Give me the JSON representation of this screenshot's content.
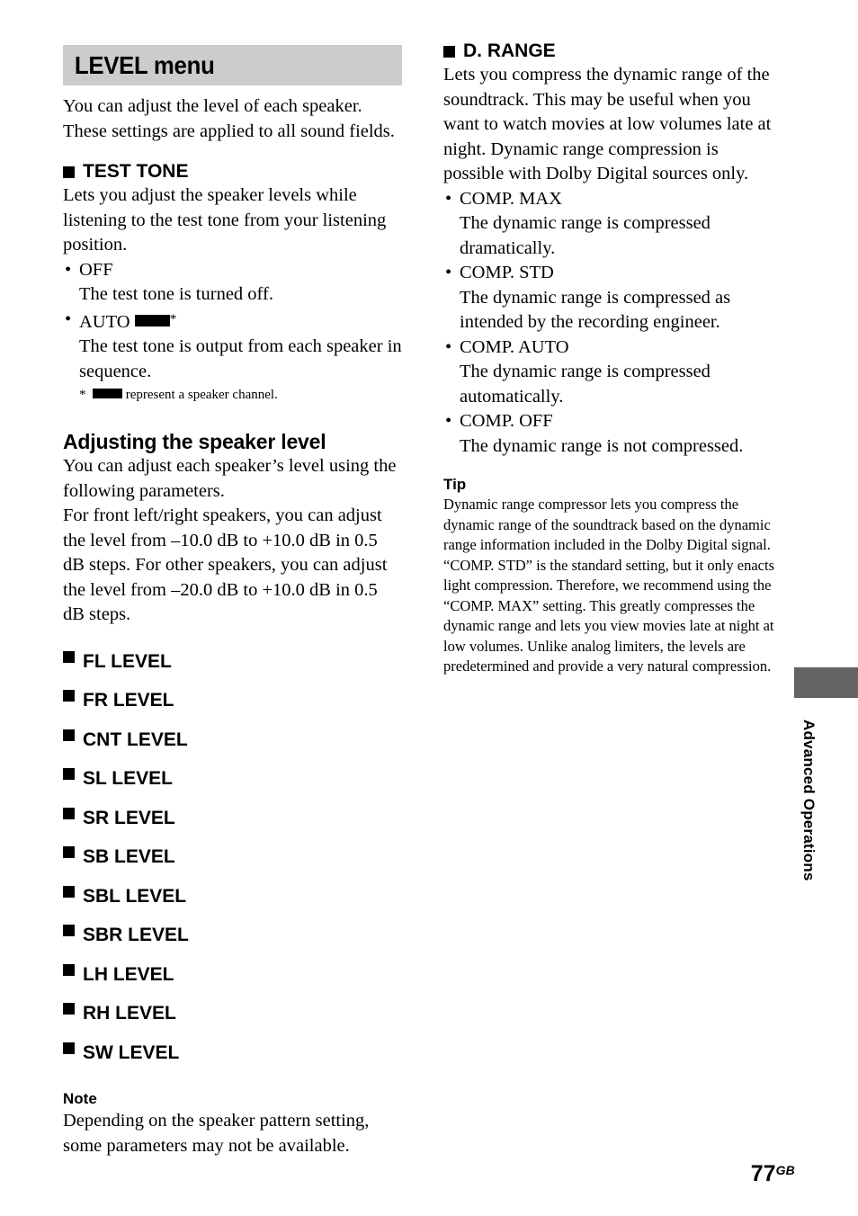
{
  "page": {
    "number": "77",
    "region_code": "GB",
    "side_tab_label": "Advanced Operations"
  },
  "left_column": {
    "banner_title": "LEVEL menu",
    "intro": "You can adjust the level of each speaker. These settings are applied to all sound fields.",
    "test_tone": {
      "heading": "TEST TONE",
      "description": "Lets you adjust the speaker levels while listening to the test tone from your listening position.",
      "options": [
        {
          "label": "OFF",
          "description": "The test tone is turned off."
        },
        {
          "label": "AUTO",
          "description": "The test tone is output from each speaker in sequence."
        }
      ],
      "footnote": "represent a speaker channel."
    },
    "adjusting": {
      "heading": "Adjusting the speaker level",
      "paragraph_1": "You can adjust each speaker’s level using the following parameters.",
      "paragraph_2": "For front left/right speakers, you can adjust the level from –10.0 dB to +10.0 dB in 0.5 dB steps. For other speakers, you can adjust the level from –20.0 dB to +10.0 dB in 0.5 dB steps."
    },
    "level_items": [
      "FL LEVEL",
      "FR LEVEL",
      "CNT LEVEL",
      "SL LEVEL",
      "SR LEVEL",
      "SB LEVEL",
      "SBL LEVEL",
      "SBR LEVEL",
      "LH LEVEL",
      "RH LEVEL",
      "SW LEVEL"
    ],
    "note": {
      "heading": "Note",
      "text": "Depending on the speaker pattern setting, some parameters may not be available."
    }
  },
  "right_column": {
    "d_range": {
      "heading": "D. RANGE",
      "description": "Lets you compress the dynamic range of the soundtrack. This may be useful when you want to watch movies at low volumes late at night. Dynamic range compression is possible with Dolby Digital sources only.",
      "options": [
        {
          "label": "COMP. MAX",
          "description": "The dynamic range is compressed dramatically."
        },
        {
          "label": "COMP. STD",
          "description": "The dynamic range is compressed as intended by the recording engineer."
        },
        {
          "label": "COMP. AUTO",
          "description": "The dynamic range is compressed automatically."
        },
        {
          "label": "COMP. OFF",
          "description": "The dynamic range is not compressed."
        }
      ]
    },
    "tip": {
      "heading": "Tip",
      "paragraph_1": "Dynamic range compressor lets you compress the dynamic range of the soundtrack based on the dynamic range information included in the Dolby Digital signal.",
      "paragraph_2": "“COMP. STD” is the standard setting, but it only enacts light compression. Therefore, we recommend using the “COMP. MAX” setting. This greatly compresses the dynamic range and lets you view movies late at night at low volumes. Unlike analog limiters, the levels are predetermined and provide a very natural compression."
    }
  },
  "colors": {
    "banner_background": "#cccccc",
    "thumb_tab": "#636363",
    "text": "#000000"
  }
}
